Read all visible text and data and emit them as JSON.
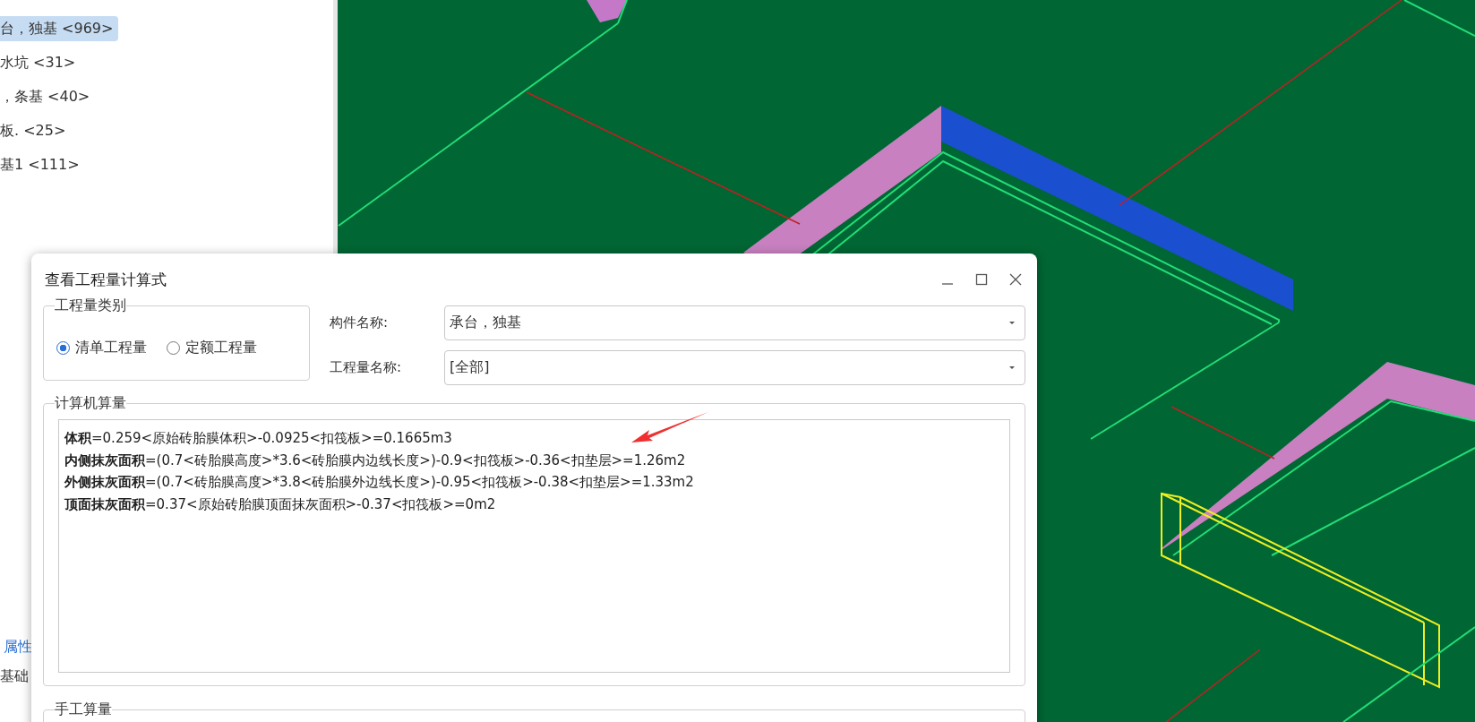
{
  "left_tree": {
    "items": [
      {
        "label": "台，独基 <969>",
        "selected": true
      },
      {
        "label": "水坑 <31>",
        "selected": false
      },
      {
        "label": "，条基 <40>",
        "selected": false
      },
      {
        "label": "板. <25>",
        "selected": false
      },
      {
        "label": "基1 <111>",
        "selected": false
      }
    ]
  },
  "left_bottom": {
    "property_tab": "属性",
    "layer_label": "基础"
  },
  "dialog": {
    "title": "查看工程量计算式",
    "quantity_type": {
      "legend": "工程量类别",
      "options": [
        {
          "label": "清单工程量",
          "selected": true
        },
        {
          "label": "定额工程量",
          "selected": false
        }
      ]
    },
    "fields": [
      {
        "label": "构件名称:",
        "value": "承台，独基"
      },
      {
        "label": "工程量名称:",
        "value": "[全部]"
      }
    ],
    "computed": {
      "legend": "计算机算量",
      "lines": [
        "**体积**=0.259<原始砖胎膜体积>-0.0925<扣筏板>=0.1665m3",
        "**内侧抹灰面积**=(0.7<砖胎膜高度>*3.6<砖胎膜内边线长度>)-0.9<扣筏板>-0.36<扣垫层>=1.26m2",
        "**外侧抹灰面积**=(0.7<砖胎膜高度>*3.8<砖胎膜外边线长度>)-0.95<扣筏板>-0.38<扣垫层>=1.33m2",
        "**顶面抹灰面积**=0.37<原始砖胎膜顶面抹灰面积>-0.37<扣筏板>=0m2"
      ]
    },
    "manual": {
      "legend": "手工算量"
    }
  }
}
